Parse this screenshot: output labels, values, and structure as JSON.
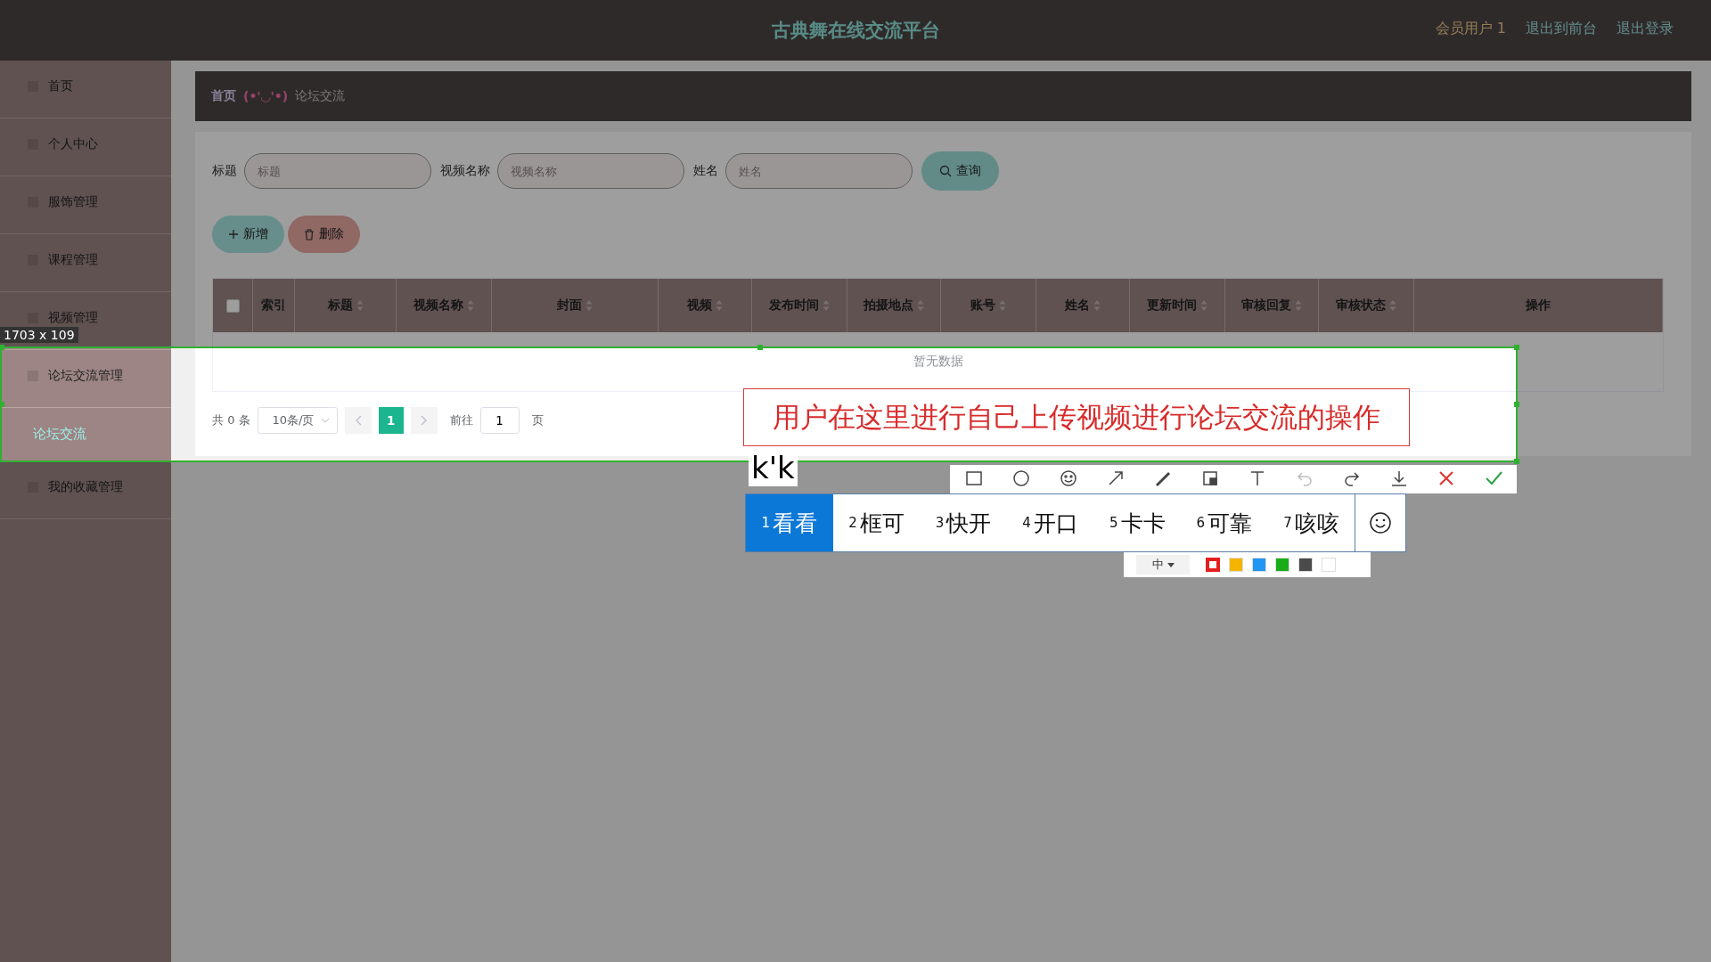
{
  "header": {
    "title": "古典舞在线交流平台",
    "user": "会员用户 1",
    "links": [
      "退出到前台",
      "退出登录"
    ]
  },
  "sidebar": {
    "items": [
      {
        "label": "首页",
        "selected": false
      },
      {
        "label": "个人中心",
        "selected": false
      },
      {
        "label": "服饰管理",
        "selected": false
      },
      {
        "label": "课程管理",
        "selected": false
      },
      {
        "label": "视频管理",
        "selected": false
      },
      {
        "label": "论坛交流管理",
        "selected": false,
        "children": [
          {
            "label": "论坛交流",
            "selected": true
          }
        ]
      },
      {
        "label": "我的收藏管理",
        "selected": false
      }
    ]
  },
  "breadcrumb": {
    "home": "首页",
    "separator": "(•'◡'•)",
    "current": "论坛交流"
  },
  "search": {
    "fields": [
      {
        "label": "标题",
        "placeholder": "标题"
      },
      {
        "label": "视频名称",
        "placeholder": "视频名称"
      },
      {
        "label": "姓名",
        "placeholder": "姓名"
      }
    ],
    "button": "查询"
  },
  "actions": [
    {
      "kind": "add",
      "label": "新增"
    },
    {
      "kind": "delete",
      "label": "删除"
    }
  ],
  "table": {
    "select_all": {
      "checked": false
    },
    "columns": [
      {
        "label": "索引",
        "sortable": false
      },
      {
        "label": "标题",
        "sortable": true
      },
      {
        "label": "视频名称",
        "sortable": true
      },
      {
        "label": "封面",
        "sortable": true
      },
      {
        "label": "视频",
        "sortable": true
      },
      {
        "label": "发布时间",
        "sortable": true
      },
      {
        "label": "拍摄地点",
        "sortable": true
      },
      {
        "label": "账号",
        "sortable": true
      },
      {
        "label": "姓名",
        "sortable": true
      },
      {
        "label": "更新时间",
        "sortable": true
      },
      {
        "label": "审核回复",
        "sortable": true
      },
      {
        "label": "审核状态",
        "sortable": true
      },
      {
        "label": "操作",
        "sortable": false
      }
    ],
    "empty_text": "暂无数据"
  },
  "pagination": {
    "total": "共 0 条",
    "page_size": "10条/页",
    "pages": [
      {
        "label": "1",
        "selected": true
      }
    ],
    "goto_label": "前往",
    "goto_value": "1",
    "goto_suffix": "页"
  },
  "capture": {
    "size": "1703 x 109",
    "annotation": "用户在这里进行自己上传视频进行论坛交流的操作",
    "tools": [
      {
        "kind": "rect",
        "disabled": false
      },
      {
        "kind": "ellipse",
        "disabled": false
      },
      {
        "kind": "mosaic",
        "disabled": false
      },
      {
        "kind": "arrow",
        "disabled": false
      },
      {
        "kind": "pen",
        "disabled": false
      },
      {
        "kind": "marker",
        "disabled": false
      },
      {
        "kind": "text",
        "disabled": false
      },
      {
        "kind": "undo",
        "disabled": true
      },
      {
        "kind": "redo",
        "disabled": false
      },
      {
        "kind": "save",
        "disabled": false
      },
      {
        "kind": "cancel",
        "disabled": false
      },
      {
        "kind": "confirm",
        "disabled": false
      }
    ],
    "font_size": "中",
    "colors": [
      {
        "color": "#e41e1e",
        "selected": true
      },
      {
        "color": "#f5b400",
        "selected": false
      },
      {
        "color": "#2196f3",
        "selected": false
      },
      {
        "color": "#1aad19",
        "selected": false
      },
      {
        "color": "#4a4a4a",
        "selected": false
      },
      {
        "color": "#ffffff",
        "selected": false
      }
    ]
  },
  "ime": {
    "composition": "k'k",
    "candidates": [
      {
        "index": "1",
        "text": "看看",
        "selected": true
      },
      {
        "index": "2",
        "text": "框可",
        "selected": false
      },
      {
        "index": "3",
        "text": "快开",
        "selected": false
      },
      {
        "index": "4",
        "text": "开口",
        "selected": false
      },
      {
        "index": "5",
        "text": "卡卡",
        "selected": false
      },
      {
        "index": "6",
        "text": "可靠",
        "selected": false
      },
      {
        "index": "7",
        "text": "咳咳",
        "selected": false
      }
    ]
  }
}
